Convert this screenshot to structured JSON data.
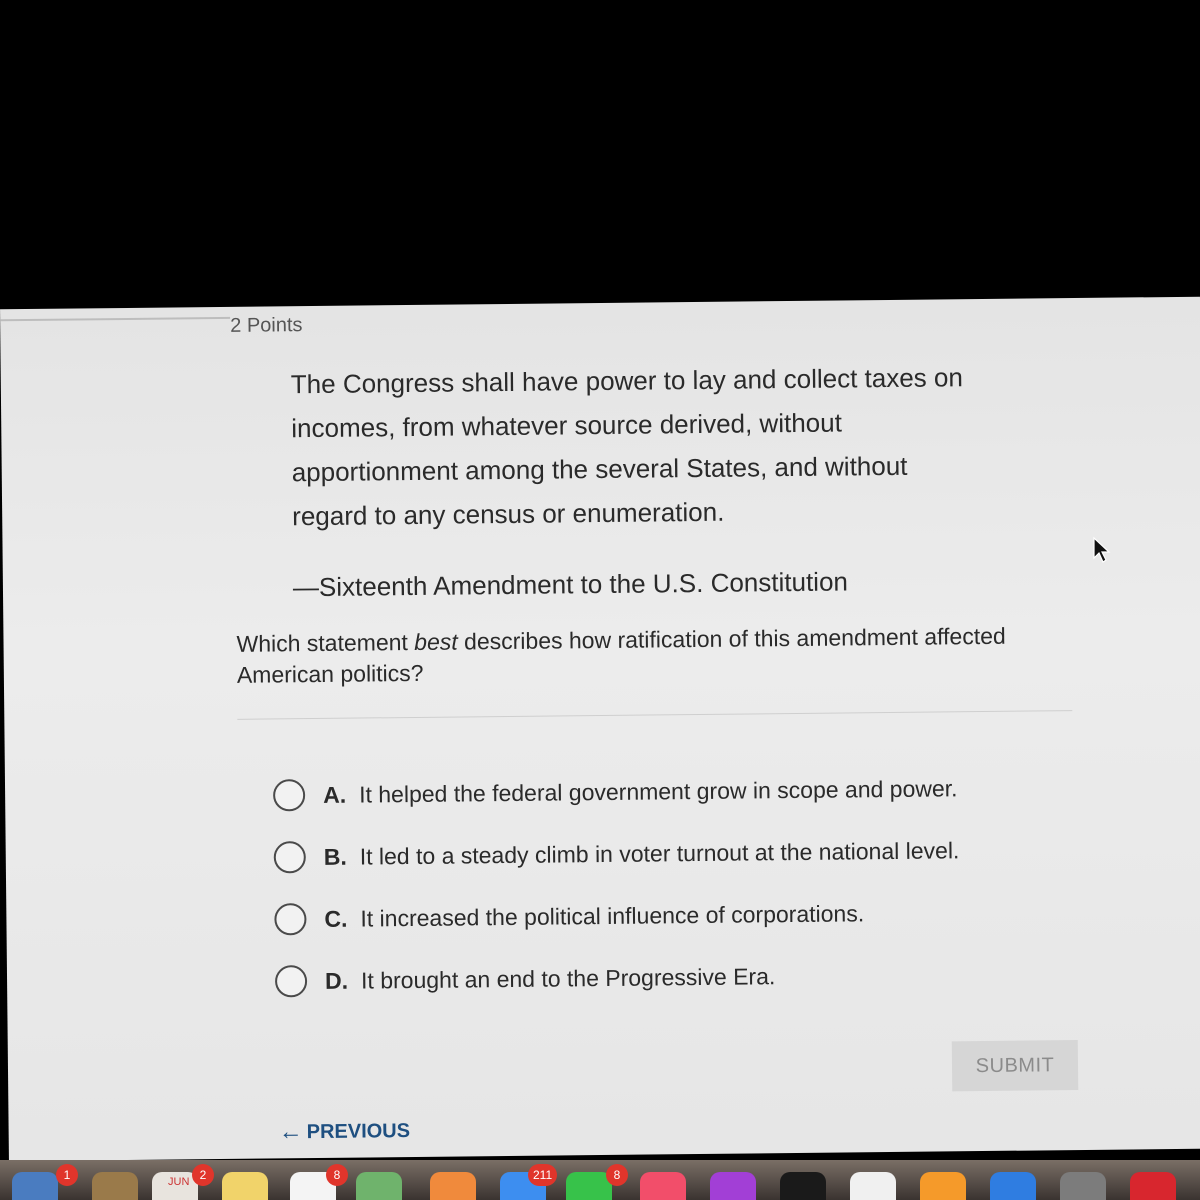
{
  "question": {
    "points": "2 Points",
    "quote_lines": [
      "The Congress shall have power to lay and collect taxes on",
      "incomes, from whatever source derived, without",
      "apportionment among the several States, and without",
      "regard to any census or enumeration."
    ],
    "attribution": "—Sixteenth Amendment to the U.S. Constitution",
    "prompt_before": "Which statement ",
    "prompt_emphasis": "best",
    "prompt_after": " describes how ratification of this amendment affected American politics?"
  },
  "options": [
    {
      "letter": "A.",
      "text": "It helped the federal government grow in scope and power."
    },
    {
      "letter": "B.",
      "text": "It led to a steady climb in voter turnout at the national level."
    },
    {
      "letter": "C.",
      "text": "It increased the political influence of corporations."
    },
    {
      "letter": "D.",
      "text": "It brought an end to the Progressive Era."
    }
  ],
  "buttons": {
    "submit": "SUBMIT",
    "previous": "PREVIOUS"
  },
  "dock": {
    "badges": [
      "1",
      "2",
      "8",
      "211",
      "8"
    ],
    "calendar_month": "JUN"
  },
  "colors": {
    "link": "#1e4f80",
    "badge": "#e0352b",
    "screen_bg": "#e9e9e9"
  }
}
